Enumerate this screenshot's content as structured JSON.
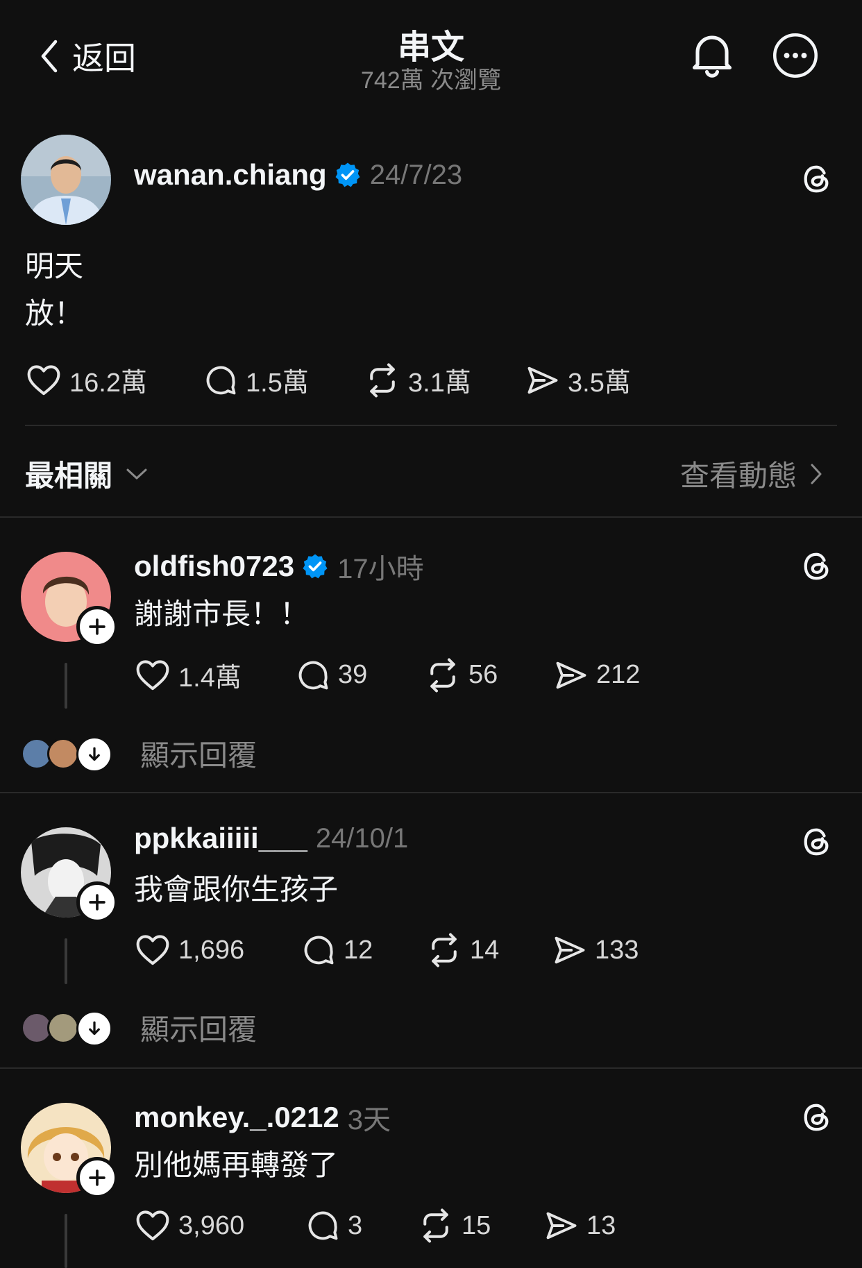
{
  "header": {
    "back_label": "返回",
    "title": "串文",
    "views": "742萬 次瀏覽"
  },
  "post": {
    "username": "wanan.chiang",
    "time": "24/7/23",
    "line1": "明天",
    "line2": "放！",
    "likes": "16.2萬",
    "comments": "1.5萬",
    "reposts": "3.1萬",
    "shares": "3.5萬"
  },
  "sort": {
    "label": "最相關",
    "activity_label": "查看動態"
  },
  "replies": [
    {
      "username": "oldfish0723",
      "time": "17小時",
      "text": "謝謝市長！！",
      "likes": "1.4萬",
      "comments": "39",
      "reposts": "56",
      "shares": "212",
      "show_replies": "顯示回覆",
      "verified": true
    },
    {
      "username": "ppkkaiiiii___",
      "time": "24/10/1",
      "text": "我會跟你生孩子",
      "likes": "1,696",
      "comments": "12",
      "reposts": "14",
      "shares": "133",
      "show_replies": "顯示回覆",
      "verified": false
    },
    {
      "username": "monkey._.0212",
      "time": "3天",
      "text": "別他媽再轉發了",
      "likes": "3,960",
      "comments": "3",
      "reposts": "15",
      "shares": "13",
      "verified": false
    }
  ],
  "colors": {
    "background": "#101010",
    "verified": "#0095f6",
    "muted": "#777777"
  }
}
